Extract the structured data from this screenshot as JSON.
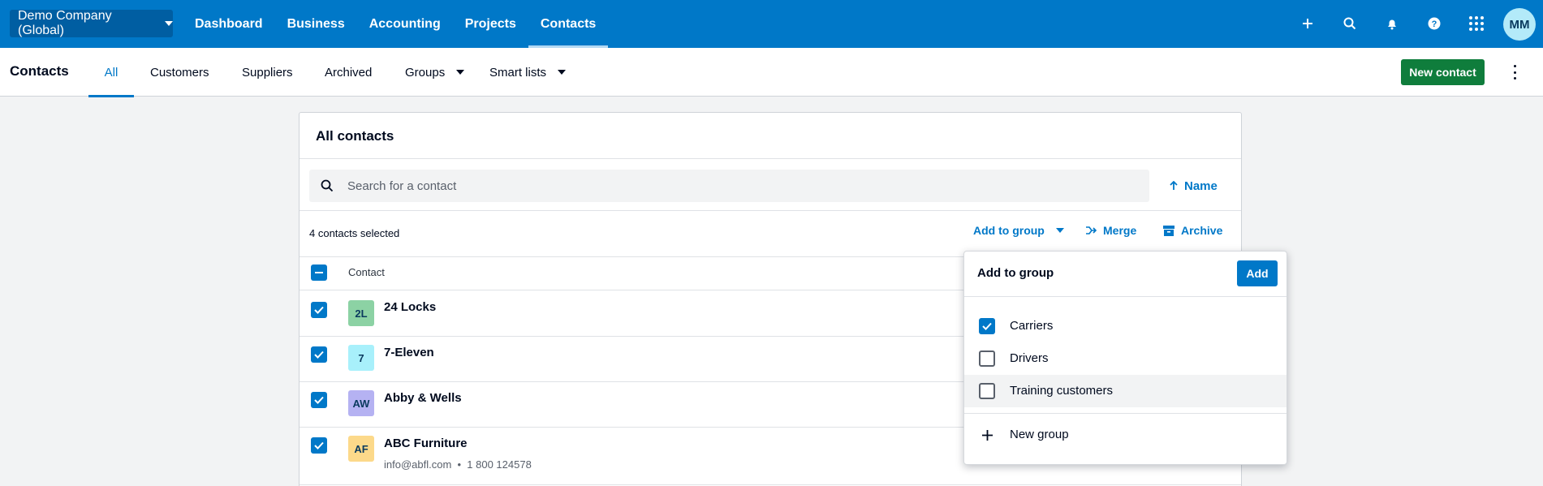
{
  "topbar": {
    "org_name": "Demo Company (Global)",
    "nav": [
      "Dashboard",
      "Business",
      "Accounting",
      "Projects",
      "Contacts"
    ],
    "active_nav": "Contacts",
    "icons": [
      "plus-icon",
      "search-icon",
      "bell-icon",
      "help-icon",
      "apps-grid-icon"
    ],
    "avatar_initials": "MM",
    "colors": {
      "bar": "#0078c8",
      "org_button": "#005ea2",
      "avatar_bg": "#b3eaf9"
    }
  },
  "subnav": {
    "title": "Contacts",
    "tabs": [
      "All",
      "Customers",
      "Suppliers",
      "Archived",
      "Groups",
      "Smart lists"
    ],
    "active_tab": "All",
    "new_contact_label": "New contact",
    "colors": {
      "new_contact": "#0f7d3c",
      "active_tab": "#0078c8"
    }
  },
  "contacts_card": {
    "title": "All contacts",
    "search_placeholder": "Search for a contact",
    "sort_label": "Name",
    "selected_count_text": "4 contacts selected",
    "actions": {
      "add_to_group": "Add to group",
      "merge": "Merge",
      "archive": "Archive"
    },
    "column_header": "Contact",
    "rows": [
      {
        "initials": "2L",
        "name": "24 Locks",
        "details": "",
        "badge_color": "#8cd2a4",
        "checked": true
      },
      {
        "initials": "7",
        "name": "7-Eleven",
        "details": "",
        "badge_color": "#a8f0fb",
        "checked": true
      },
      {
        "initials": "AW",
        "name": "Abby & Wells",
        "details": "",
        "badge_color": "#b5b2f2",
        "checked": true
      },
      {
        "initials": "AF",
        "name": "ABC Furniture",
        "details": "info@abfl.com  •  1 800 124578",
        "badge_color": "#fcd98a",
        "checked": true
      }
    ]
  },
  "add_to_group_dropdown": {
    "title": "Add to group",
    "add_label": "Add",
    "groups": [
      {
        "name": "Carriers",
        "checked": true
      },
      {
        "name": "Drivers",
        "checked": false
      },
      {
        "name": "Training customers",
        "checked": false
      }
    ],
    "new_group_label": "New group"
  }
}
